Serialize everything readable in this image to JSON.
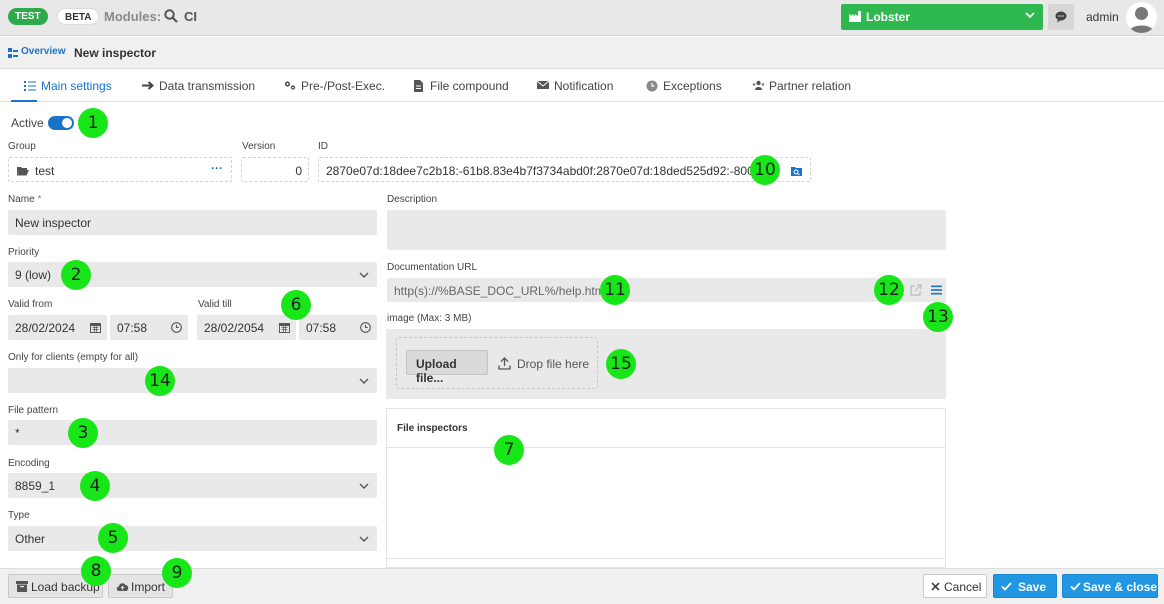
{
  "topbar": {
    "badge_test": "TEST",
    "badge_beta": "BETA",
    "modules_label": "Modules:",
    "module_name": "CI",
    "instance_name": "Lobster",
    "user_name": "admin",
    "colors": {
      "instance_bg": "#2fb84f",
      "test_badge": "#2eaa4a"
    }
  },
  "breadcrumb": {
    "root": "Overview",
    "current": "New inspector"
  },
  "tabs": [
    {
      "label": "Main settings",
      "icon": "list-icon",
      "active": true
    },
    {
      "label": "Data transmission",
      "icon": "arrow-right-icon"
    },
    {
      "label": "Pre-/Post-Exec.",
      "icon": "gears-icon"
    },
    {
      "label": "File compound",
      "icon": "file-icon"
    },
    {
      "label": "Notification",
      "icon": "envelope-icon"
    },
    {
      "label": "Exceptions",
      "icon": "clock-icon"
    },
    {
      "label": "Partner relation",
      "icon": "partners-icon"
    }
  ],
  "form": {
    "active_label": "Active",
    "active": true,
    "group_label": "Group",
    "group_value": "test",
    "version_label": "Version",
    "version_value": "0",
    "id_label": "ID",
    "id_value": "2870e07d:18dee7c2b18:-61b8.83e4b7f3734abd0f:2870e07d:18ded525d92:-8000",
    "name_label": "Name",
    "name_required": "*",
    "name_value": "New inspector",
    "description_label": "Description",
    "description_value": "",
    "priority_label": "Priority",
    "priority_value": "9 (low)",
    "doc_url_label": "Documentation URL",
    "doc_url_value": "http(s)://%BASE_DOC_URL%/help.html",
    "valid_from_label": "Valid from",
    "valid_from_date": "28/02/2024",
    "valid_from_time": "07:58",
    "valid_till_label": "Valid till",
    "valid_till_date": "28/02/2054",
    "valid_till_time": "07:58",
    "image_label": "image (Max: 3 MB)",
    "upload_label": "Upload file...",
    "drop_label": "Drop file here",
    "clients_label": "Only for clients (empty for all)",
    "clients_value": "",
    "file_pattern_label": "File pattern",
    "file_pattern_value": "*",
    "encoding_label": "Encoding",
    "encoding_value": "8859_1",
    "type_label": "Type",
    "type_value": "Other",
    "file_inspectors_label": "File inspectors"
  },
  "markers": [
    "1",
    "2",
    "3",
    "4",
    "5",
    "6",
    "7",
    "8",
    "9",
    "10",
    "11",
    "12",
    "13",
    "14",
    "15"
  ],
  "bottombar": {
    "load_backup": "Load backup",
    "import": "Import",
    "cancel": "Cancel",
    "save": "Save",
    "save_close": "Save & close"
  }
}
